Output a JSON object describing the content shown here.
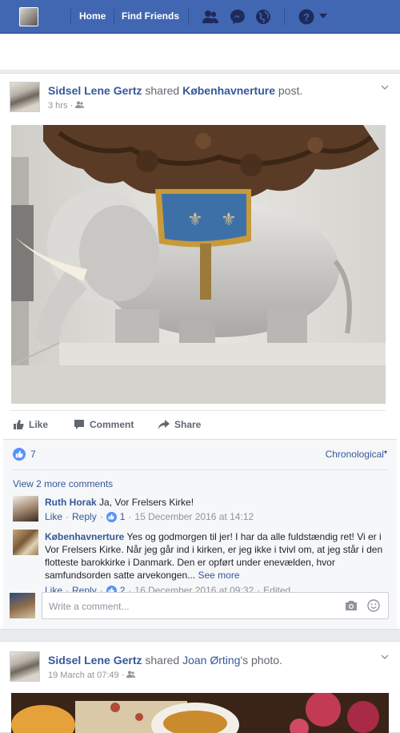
{
  "topbar": {
    "nav": [
      "Home",
      "Find Friends"
    ],
    "icons": [
      "friend-requests-icon",
      "messenger-icon",
      "notifications-globe-icon",
      "help-icon",
      "account-dropdown-icon"
    ],
    "brand_color": "#4267b2"
  },
  "post1": {
    "author": "Sidsel Lene Gertz",
    "verb1": "shared",
    "page": "Københavnerture",
    "verb2": "post.",
    "time": "3 hrs",
    "privacy_icon": "friends-icon",
    "actions": {
      "like": "Like",
      "comment": "Comment",
      "share": "Share"
    },
    "like_count": "7",
    "sort": "Chronological",
    "view_more": "View 2 more comments",
    "comments": [
      {
        "name": "Ruth Horak",
        "text": "Ja, Vor Frelsers Kirke!",
        "like": "Like",
        "reply": "Reply",
        "likes": "1",
        "date": "15 December 2016 at 14:12"
      },
      {
        "name": "Københavnerture",
        "text_line1": "Yes og godmorgen til jer! I har da alle fuldstændig ret! Vi er i",
        "text_line2": "Vor Frelsers Kirke. Når jeg går ind i kirken, er jeg ikke i tvivl om, at jeg står i den",
        "text_line3": "flotteste barokkirke i Danmark. Den er opført under enevælden, hvor",
        "text_line4": "samfundsorden satte arvekongen...",
        "see_more": "See more",
        "like": "Like",
        "reply": "Reply",
        "likes": "2",
        "date": "16 December 2016 at 09:32",
        "edited": "Edited"
      }
    ],
    "write_placeholder": "Write a comment..."
  },
  "post2": {
    "author": "Sidsel Lene Gertz",
    "verb": "shared",
    "owner": "Joan Ørting",
    "suffix": "'s photo.",
    "time": "19 March at 07:49",
    "privacy_icon": "friends-icon"
  }
}
